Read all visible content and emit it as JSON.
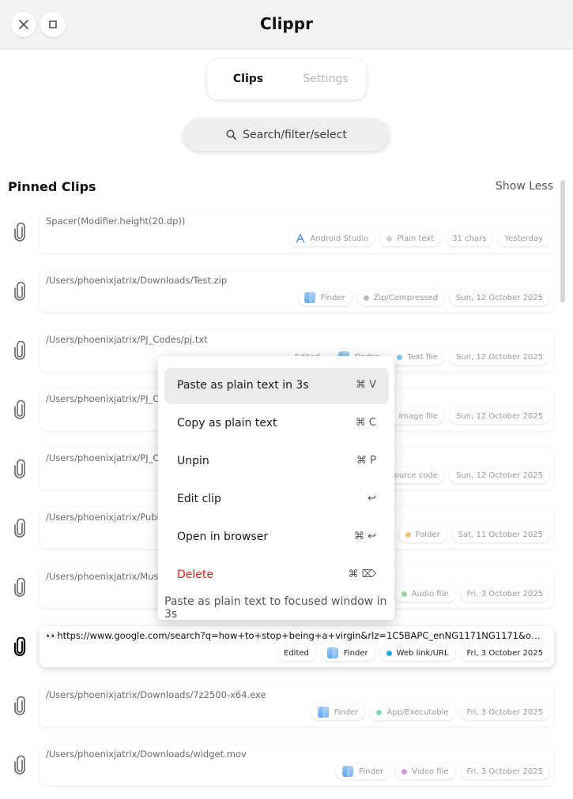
{
  "window": {
    "title": "Clippr"
  },
  "tabs": [
    {
      "label": "Clips"
    },
    {
      "label": "Settings"
    }
  ],
  "search": {
    "placeholder": "Search/filter/select"
  },
  "section": {
    "title": "Pinned Clips",
    "toggle": "Show Less"
  },
  "clips": [
    {
      "text": "Spacer(Modifier.height(20.dp))",
      "tags": [
        "Android Studio",
        "Plain text",
        "31 chars",
        "Yesterday"
      ]
    },
    {
      "text": "/Users/phoenixjatrix/Downloads/Test.zip",
      "tags": [
        "Finder",
        "Zip/Compressed",
        "Sun, 12 October 2025"
      ]
    },
    {
      "text": "/Users/phoenixjatrix/PJ_Codes/pj.txt",
      "tags": [
        "Edited",
        "Finder",
        "Text file",
        "Sun, 12 October 2025"
      ]
    },
    {
      "text": "/Users/phoenixjatrix/PJ_C",
      "tags": [
        "Image file",
        "Sun, 12 October 2025"
      ]
    },
    {
      "text": "/Users/phoenixjatrix/PJ_C",
      "tags": [
        "Source code",
        "Sun, 12 October 2025"
      ]
    },
    {
      "text": "/Users/phoenixjatrix/Publ",
      "tags": [
        "er",
        "Folder",
        "Sat, 11 October 2025"
      ]
    },
    {
      "text": "/Users/phoenixjatrix/Mus",
      "tags": [
        "Audio file",
        "Fri, 3 October 2025"
      ]
    },
    {
      "text": "👀https://www.google.com/search?q=how+to+stop+being+a+virgin&rlz=1C5BAPC_enNG1171NG1171&oq=how+to+stop+being+a+virgin&gs_lcrp",
      "tags": [
        "Edited",
        "Finder",
        "Web link/URL",
        "Fri, 3 October 2025"
      ]
    },
    {
      "text": "/Users/phoenixjatrix/Downloads/7z2500-x64.exe",
      "tags": [
        "Finder",
        "App/Executable",
        "Fri, 3 October 2025"
      ]
    },
    {
      "text": "/Users/phoenixjatrix/Downloads/widget.mov",
      "tags": [
        "Finder",
        "Video file",
        "Fri, 3 October 2025"
      ]
    }
  ],
  "tag_colors": {
    "Plain text": "#cfcfcf",
    "Zip/Compressed": "#b5bcc8",
    "Text file": "#7cc8f2",
    "Image file": "#f27aa0",
    "Source code": "#8e9ad6",
    "Folder": "#f6c27a",
    "Audio file": "#9ad9a8",
    "Web link/URL": "#2aa9e0",
    "App/Executable": "#7fd4c0",
    "Video file": "#d39ae0"
  },
  "context_menu": {
    "items": [
      {
        "label": "Paste as plain text in 3s",
        "shortcut": "⌘ V"
      },
      {
        "label": "Copy as plain text",
        "shortcut": "⌘ C"
      },
      {
        "label": "Unpin",
        "shortcut": "⌘ P"
      },
      {
        "label": "Edit clip",
        "shortcut": "↩"
      },
      {
        "label": "Open in browser",
        "shortcut": "⌘ ↩"
      },
      {
        "label": "Delete",
        "shortcut": "⌘ ⌦"
      }
    ],
    "hint": "Paste as plain text to focused window in 3s"
  }
}
